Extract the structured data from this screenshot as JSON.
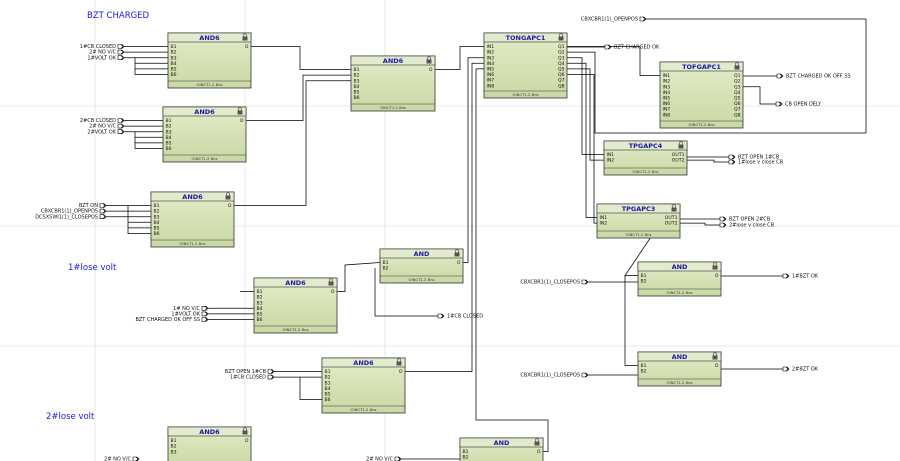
{
  "notes": [
    "BZT CHARGED",
    "1#lose volt",
    "2#lose volt"
  ],
  "blocks": [
    {
      "title": "AND6",
      "inputs": [
        "B1",
        "B2",
        "B3",
        "B4",
        "B5",
        "B6"
      ],
      "outputs": [
        "O"
      ],
      "footer": "OINCT1.2 8ns"
    },
    {
      "title": "AND6",
      "inputs": [
        "B1",
        "B2",
        "B3",
        "B4",
        "B5",
        "B6"
      ],
      "outputs": [
        "O"
      ],
      "footer": "OINCT1.2 8ns"
    },
    {
      "title": "AND6",
      "inputs": [
        "B1",
        "B2",
        "B3",
        "B4",
        "B5",
        "B6"
      ],
      "outputs": [
        "O"
      ],
      "footer": "OINCT1.2 8ns"
    },
    {
      "title": "AND6",
      "inputs": [
        "B1",
        "B2",
        "B3",
        "B4",
        "B5",
        "B6"
      ],
      "outputs": [
        "O"
      ],
      "footer": "OINCT1.2 8ns"
    },
    {
      "title": "TONGAPC1",
      "inputs": [
        "IN1",
        "IN2",
        "IN3",
        "IN4",
        "IN5",
        "IN6",
        "IN7",
        "IN8"
      ],
      "outputs": [
        "Q1",
        "Q2",
        "Q3",
        "Q4",
        "Q5",
        "Q6",
        "Q7",
        "Q8"
      ],
      "footer": "OINCT1.2 8ns"
    },
    {
      "title": "TOFGAPC1",
      "inputs": [
        "IN1",
        "IN2",
        "IN3",
        "IN4",
        "IN5",
        "IN6",
        "IN7",
        "IN8"
      ],
      "outputs": [
        "Q1",
        "Q2",
        "Q3",
        "Q4",
        "Q5",
        "Q6",
        "Q7",
        "Q8"
      ],
      "footer": "OINCT1.2 8ns"
    },
    {
      "title": "TPGAPC4",
      "inputs": [
        "IN1",
        "IN2"
      ],
      "outputs": [
        "OUT1",
        "OUT2"
      ],
      "footer": "OINCT1.2 8ns"
    },
    {
      "title": "TPGAPC3",
      "inputs": [
        "IN1",
        "IN2"
      ],
      "outputs": [
        "OUT1",
        "OUT2"
      ],
      "footer": "OINCT1.2 8ns"
    },
    {
      "title": "AND",
      "inputs": [
        "B1",
        "B2"
      ],
      "outputs": [
        "O"
      ],
      "footer": "OINCT1.2 8ns"
    },
    {
      "title": "AND6",
      "inputs": [
        "B1",
        "B2",
        "B3",
        "B4",
        "B5",
        "B6"
      ],
      "outputs": [
        "O"
      ],
      "footer": "OINCT1.2 8ns"
    },
    {
      "title": "AND",
      "inputs": [
        "B1",
        "B2"
      ],
      "outputs": [
        "O"
      ],
      "footer": "OINCT1.2 8ns"
    },
    {
      "title": "AND6",
      "inputs": [
        "B1",
        "B2",
        "B3",
        "B4",
        "B5",
        "B6"
      ],
      "outputs": [
        "O"
      ],
      "footer": "OINCT1.2 8ns"
    },
    {
      "title": "AND",
      "inputs": [
        "B1",
        "B2"
      ],
      "outputs": [
        "O"
      ],
      "footer": "OINCT1.2 8ns"
    },
    {
      "title": "AND6",
      "inputs": [
        "B1",
        "B2",
        "B3"
      ],
      "outputs": [
        "O"
      ],
      "footer": ""
    },
    {
      "title": "AND",
      "inputs": [
        "B1",
        "B2"
      ],
      "outputs": [
        "O"
      ],
      "footer": ""
    }
  ],
  "inputs": [
    "1#CB CLOSED",
    "2# NO V/C",
    "1#VOLT OK",
    "2#CB CLOSED",
    "2# NO V/C",
    "2#VOLT OK",
    "BZT ON",
    "CBXCBR1(1)_OPENPOS",
    "DCSXSWI1(1)_CLOSEPOS",
    "1# NO V/C",
    "1#VOLT OK",
    "BZT CHARGED OK OFF SS",
    "BZT OPEN 1#CB",
    "1#CB CLOSED",
    "CBXCBR1(1)_OPENPOS",
    "CBXCBR1(1)_CLOSEPOS",
    "CBXCBR1(1)_CLOSEPOS",
    "2# NO V/C",
    "2#CB CLOSED"
  ],
  "outputs": [
    "BZT CHARGED OK",
    "BZT CHARGED OK OFF SS",
    "CB OPEN DELY",
    "BZT OPEN 1#CB",
    "1#lose v close CB",
    "BZT OPEN 2#CB",
    "2#lose v close CB",
    "1#BZT OK",
    "2#BZT OK",
    "1#CB CLOSED"
  ],
  "colors": {
    "block_fill": "#d6e2b7",
    "block_border": "#333333",
    "header": "#e2ebcd",
    "title": "#1a1aa6",
    "note": "#1a1ae6",
    "wire": "#000000",
    "grid": "#d8d8d8"
  }
}
